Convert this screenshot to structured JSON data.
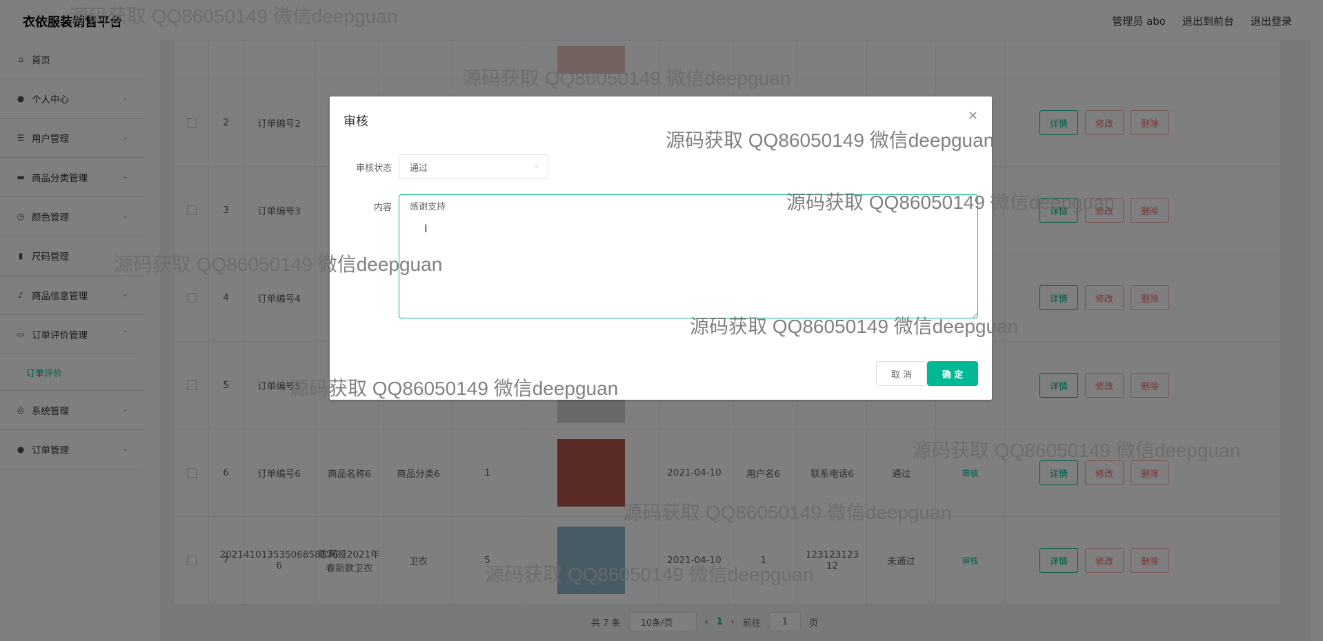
{
  "header": {
    "brand": "衣依服装销售平台",
    "admin": "管理员 abo",
    "to_front": "退出到前台",
    "logout": "退出登录"
  },
  "sidebar": {
    "items": [
      {
        "label": "首页",
        "icon": "home-icon"
      },
      {
        "label": "个人中心",
        "icon": "user-icon"
      },
      {
        "label": "用户管理",
        "icon": "list-icon"
      },
      {
        "label": "商品分类管理",
        "icon": "folder-icon"
      },
      {
        "label": "颜色管理",
        "icon": "clock-icon"
      },
      {
        "label": "尺码管理",
        "icon": "chart-icon"
      },
      {
        "label": "商品信息管理",
        "icon": "mic-icon"
      },
      {
        "label": "订单评价管理",
        "icon": "message-icon"
      },
      {
        "label": "系统管理",
        "icon": "compass-icon"
      },
      {
        "label": "订单管理",
        "icon": "user-icon"
      }
    ],
    "sub_item": "订单评价"
  },
  "table": {
    "rows": [
      {
        "idx": "2",
        "order": "订单编号2",
        "name": "",
        "cat": "",
        "qty": "",
        "date": "",
        "user": "",
        "phone": "",
        "status": ""
      },
      {
        "idx": "3",
        "order": "订单编号3",
        "name": "",
        "cat": "",
        "qty": "",
        "date": "",
        "user": "",
        "phone": "",
        "status": ""
      },
      {
        "idx": "4",
        "order": "订单编号4",
        "name": "",
        "cat": "",
        "qty": "",
        "date": "",
        "user": "",
        "phone": "",
        "status": ""
      },
      {
        "idx": "5",
        "order": "订单编号5",
        "name": "",
        "cat": "",
        "qty": "",
        "date": "",
        "user": "",
        "phone": "",
        "status": ""
      },
      {
        "idx": "6",
        "order": "订单编号6",
        "name": "商品名称6",
        "cat": "商品分类6",
        "qty": "1",
        "date": "2021-04-10",
        "user": "用户名6",
        "phone": "联系电话6",
        "status": "通过"
      },
      {
        "idx": "7",
        "order": "20214101353506858176 6",
        "name": "歌莉娅2021年春新款卫衣",
        "cat": "卫衣",
        "qty": "5",
        "date": "2021-04-10",
        "user": "1",
        "phone": "123123123 12",
        "status": "未通过"
      }
    ],
    "audit": "审核",
    "detail": "详情",
    "edit": "修改",
    "delete": "删除"
  },
  "pager": {
    "total": "共 7 条",
    "size": "10条/页",
    "page": "1",
    "goto": "前往",
    "goto_value": "1",
    "page_unit": "页"
  },
  "dialog": {
    "title": "审核",
    "status_label": "审核状态",
    "status_value": "通过",
    "content_label": "内容",
    "content_value": "感谢支持",
    "cancel": "取 消",
    "confirm": "确 定"
  },
  "watermark": "源码获取 QQ86050149 微信deepguan",
  "colors": {
    "accent": "#00b893",
    "danger": "#f56c6c"
  }
}
